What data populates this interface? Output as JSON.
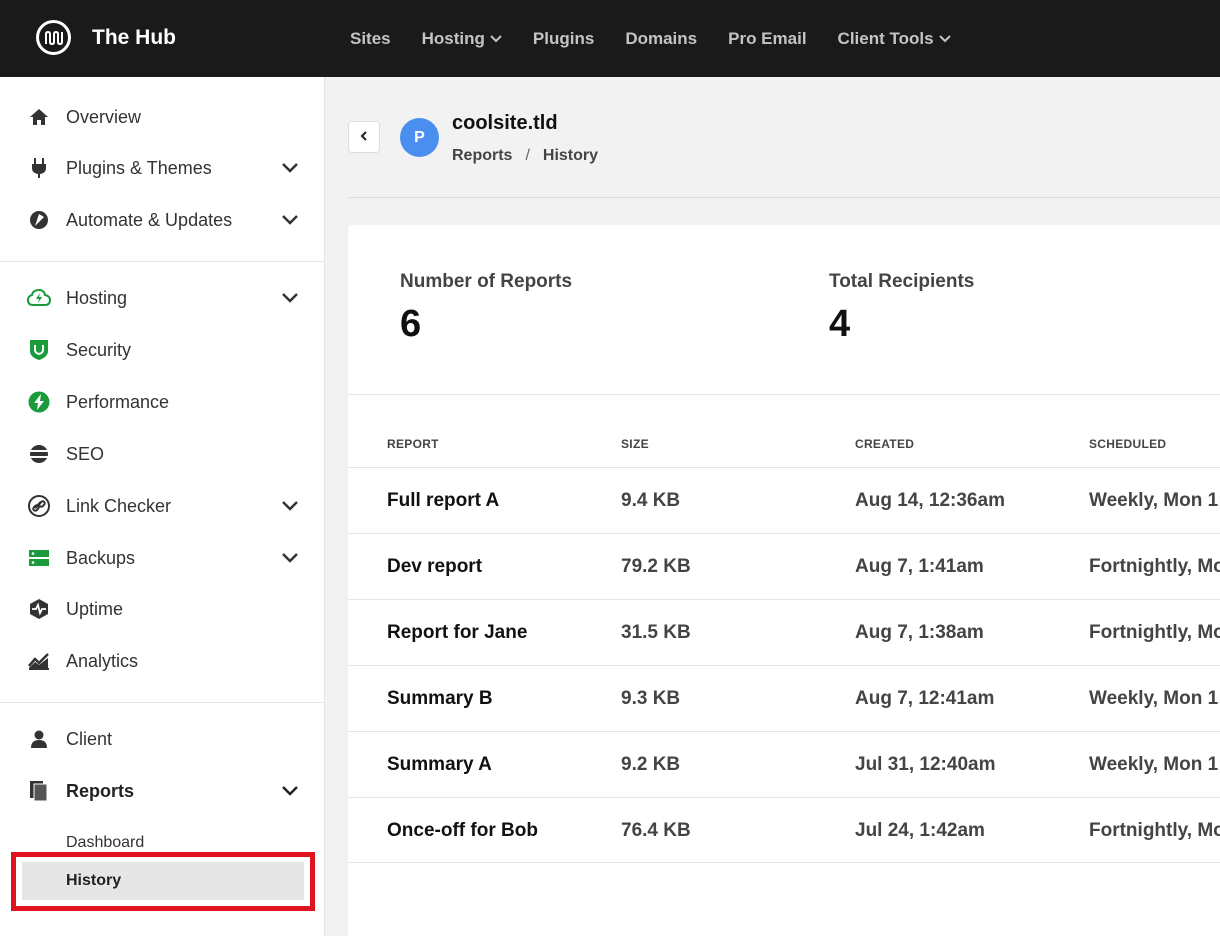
{
  "brand": {
    "title": "The Hub"
  },
  "topnav": [
    {
      "label": "Sites",
      "dropdown": false
    },
    {
      "label": "Hosting",
      "dropdown": true
    },
    {
      "label": "Plugins",
      "dropdown": false
    },
    {
      "label": "Domains",
      "dropdown": false
    },
    {
      "label": "Pro Email",
      "dropdown": false
    },
    {
      "label": "Client Tools",
      "dropdown": true
    }
  ],
  "sidebar": {
    "items": [
      {
        "label": "Overview",
        "icon": "home-icon"
      },
      {
        "label": "Plugins & Themes",
        "icon": "plug-icon"
      },
      {
        "label": "Automate & Updates",
        "icon": "automate-icon"
      },
      {
        "label": "Hosting",
        "icon": "cloud-icon"
      },
      {
        "label": "Security",
        "icon": "shield-icon"
      },
      {
        "label": "Performance",
        "icon": "bolt-icon"
      },
      {
        "label": "SEO",
        "icon": "seo-icon"
      },
      {
        "label": "Link Checker",
        "icon": "link-icon"
      },
      {
        "label": "Backups",
        "icon": "backups-icon"
      },
      {
        "label": "Uptime",
        "icon": "uptime-icon"
      },
      {
        "label": "Analytics",
        "icon": "analytics-icon"
      },
      {
        "label": "Client",
        "icon": "user-icon"
      },
      {
        "label": "Reports",
        "icon": "reports-icon"
      }
    ],
    "sub": {
      "dashboard": "Dashboard",
      "history": "History"
    }
  },
  "header": {
    "avatar_letter": "P",
    "site": "coolsite.tld",
    "breadcrumb": [
      "Reports",
      "History"
    ],
    "separator": "/"
  },
  "stats": {
    "reports_label": "Number of Reports",
    "reports_value": "6",
    "recipients_label": "Total Recipients",
    "recipients_value": "4"
  },
  "table": {
    "headers": [
      "REPORT",
      "SIZE",
      "CREATED",
      "SCHEDULED"
    ],
    "rows": [
      {
        "name": "Full report A",
        "size": "9.4 KB",
        "created": "Aug 14, 12:36am",
        "scheduled": "Weekly, Mon 1:"
      },
      {
        "name": "Dev report",
        "size": "79.2 KB",
        "created": "Aug 7, 1:41am",
        "scheduled": "Fortnightly, Mo"
      },
      {
        "name": "Report for Jane",
        "size": "31.5 KB",
        "created": "Aug 7, 1:38am",
        "scheduled": "Fortnightly, Mo"
      },
      {
        "name": "Summary B",
        "size": "9.3 KB",
        "created": "Aug 7, 12:41am",
        "scheduled": "Weekly, Mon 1:"
      },
      {
        "name": "Summary A",
        "size": "9.2 KB",
        "created": "Jul 31, 12:40am",
        "scheduled": "Weekly, Mon 1:"
      },
      {
        "name": "Once-off for Bob",
        "size": "76.4 KB",
        "created": "Jul 24, 1:42am",
        "scheduled": "Fortnightly, Mo"
      }
    ]
  },
  "colors": {
    "accent_green": "#1a9a3a",
    "avatar_blue": "#4a8ff0",
    "highlight_red": "#e0141e"
  }
}
